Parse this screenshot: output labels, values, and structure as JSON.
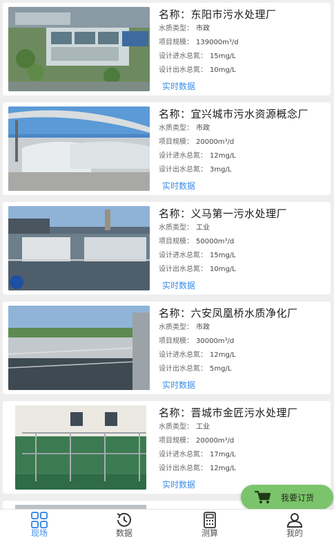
{
  "stations": [
    {
      "name": "名称：东阳市污水处理厂",
      "water_type_label": "水质类型：",
      "water_type": "市政",
      "scale_label": "项目规模：",
      "scale": "139000m³/d",
      "in_n_label": "设计进水总氮：",
      "in_n": "15mg/L",
      "out_n_label": "设计出水总氮：",
      "out_n": "10mg/L",
      "link": "实时数据"
    },
    {
      "name": "名称：宜兴城市污水资源概念厂",
      "water_type_label": "水质类型：",
      "water_type": "市政",
      "scale_label": "项目规模：",
      "scale": "20000m³/d",
      "in_n_label": "设计进水总氮：",
      "in_n": "12mg/L",
      "out_n_label": "设计出水总氮：",
      "out_n": "3mg/L",
      "link": "实时数据"
    },
    {
      "name": "名称：义马第一污水处理厂",
      "water_type_label": "水质类型：",
      "water_type": "工业",
      "scale_label": "项目规模：",
      "scale": "50000m³/d",
      "in_n_label": "设计进水总氮：",
      "in_n": "15mg/L",
      "out_n_label": "设计出水总氮：",
      "out_n": "10mg/L",
      "link": "实时数据"
    },
    {
      "name": "名称：六安凤凰桥水质净化厂",
      "water_type_label": "水质类型：",
      "water_type": "市政",
      "scale_label": "项目规模：",
      "scale": "30000m³/d",
      "in_n_label": "设计进水总氮：",
      "in_n": "12mg/L",
      "out_n_label": "设计出水总氮：",
      "out_n": "5mg/L",
      "link": "实时数据"
    },
    {
      "name": "名称：晋城市金匠污水处理厂",
      "water_type_label": "水质类型：",
      "water_type": "工业",
      "scale_label": "项目规模：",
      "scale": "20000m³/d",
      "in_n_label": "设计进水总氮：",
      "in_n": "17mg/L",
      "out_n_label": "设计出水总氮：",
      "out_n": "12mg/L",
      "link": "实时数据"
    }
  ],
  "order_button": {
    "label": "我要订货",
    "icon": "shopping-cart-icon"
  },
  "tabbar": {
    "tabs": [
      {
        "label": "现场",
        "icon": "grid-icon",
        "active": true
      },
      {
        "label": "数据",
        "icon": "history-icon",
        "active": false
      },
      {
        "label": "测算",
        "icon": "calculator-icon",
        "active": false
      },
      {
        "label": "我的",
        "icon": "user-icon",
        "active": false
      }
    ]
  },
  "colors": {
    "accent": "#3d8ee8",
    "order_button": "#7bc46b",
    "background": "#eeeeee"
  }
}
